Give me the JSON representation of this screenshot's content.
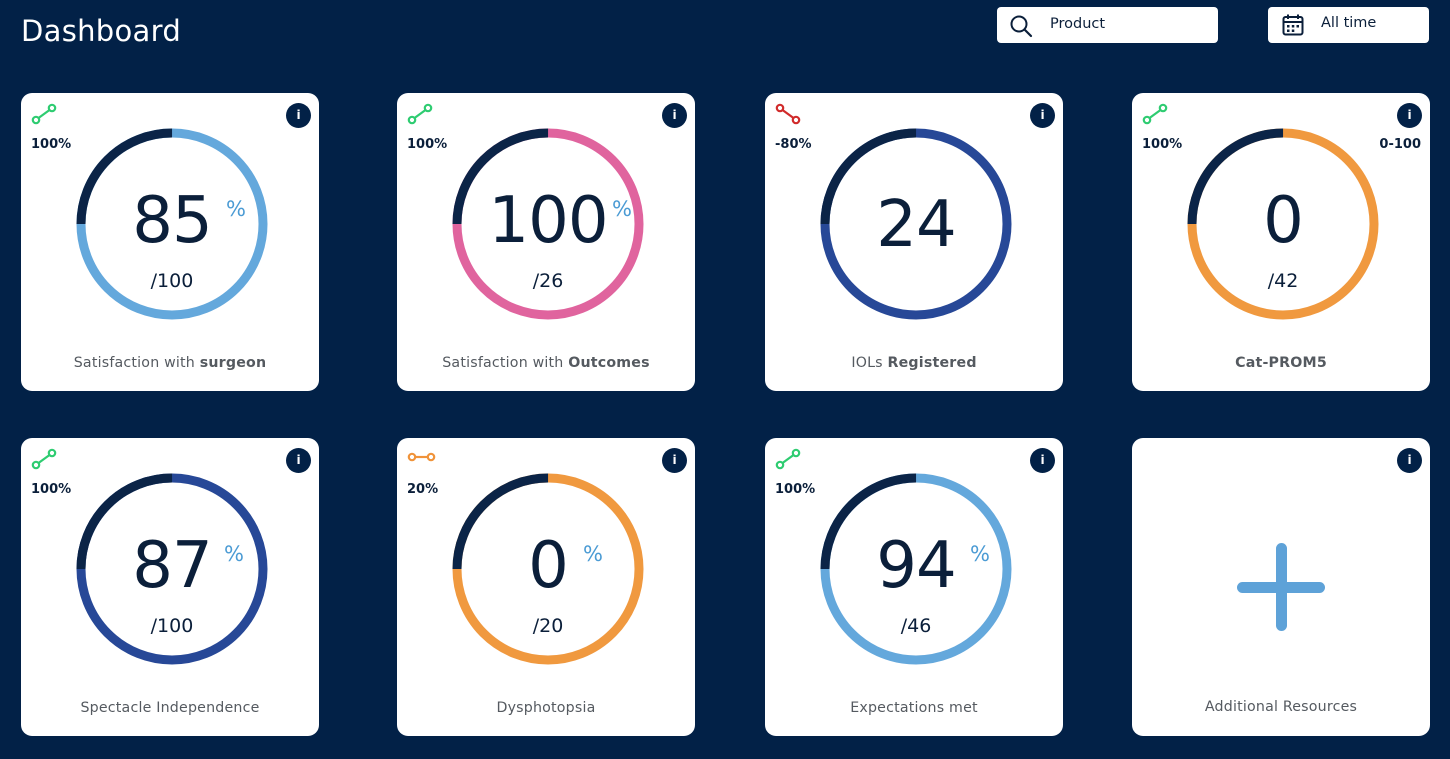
{
  "header": {
    "title": "Dashboard",
    "product_filter": {
      "label": "Product",
      "icon": "search-icon"
    },
    "time_filter": {
      "label": "All time",
      "icon": "calendar-icon"
    }
  },
  "colors": {
    "background": "#022147",
    "ring_dark": "#0b2447",
    "trend_up": "#2ecc71",
    "trend_down": "#d12b2b",
    "trend_flat": "#f0933a",
    "light_blue": "#64a8dc",
    "pink": "#e0649e",
    "royal_blue": "#274897",
    "orange": "#f0993f",
    "percent_sign": "#4b9bd4"
  },
  "cards": [
    {
      "trend": "up",
      "change": "100%",
      "value": "85",
      "unit": "%",
      "denominator": "/100",
      "label_prefix": "Satisfaction with ",
      "label_bold": "surgeon",
      "range": "",
      "fraction": 0.85,
      "color": "#64a8dc"
    },
    {
      "trend": "up",
      "change": "100%",
      "value": "100",
      "unit": "%",
      "denominator": "/26",
      "label_prefix": "Satisfaction with ",
      "label_bold": "Outcomes",
      "range": "",
      "fraction": 1.0,
      "color": "#e0649e"
    },
    {
      "trend": "down",
      "change": "-80%",
      "value": "24",
      "unit": "",
      "denominator": "",
      "label_prefix": "IOLs ",
      "label_bold": "Registered",
      "range": "",
      "fraction": 1.0,
      "color": "#274897"
    },
    {
      "trend": "up",
      "change": "100%",
      "value": "0",
      "unit": "",
      "denominator": "/42",
      "label_prefix": "",
      "label_bold": "Cat-PROM5",
      "range": "0-100",
      "fraction": 1.0,
      "color": "#f0993f"
    },
    {
      "trend": "up",
      "change": "100%",
      "value": "87",
      "unit": "%",
      "denominator": "/100",
      "label_prefix": "Spectacle Independence",
      "label_bold": "",
      "range": "",
      "fraction": 1.0,
      "color": "#274897"
    },
    {
      "trend": "flat",
      "change": "20%",
      "value": "0",
      "unit": "%",
      "denominator": "/20",
      "label_prefix": "Dysphotopsia",
      "label_bold": "",
      "range": "",
      "fraction": 1.0,
      "color": "#f0993f"
    },
    {
      "trend": "up",
      "change": "100%",
      "value": "94",
      "unit": "%",
      "denominator": "/46",
      "label_prefix": "Expectations met",
      "label_bold": "",
      "range": "",
      "fraction": 1.0,
      "color": "#64a8dc"
    }
  ],
  "resources_card": {
    "label": "Additional Resources",
    "icon": "plus-icon"
  }
}
